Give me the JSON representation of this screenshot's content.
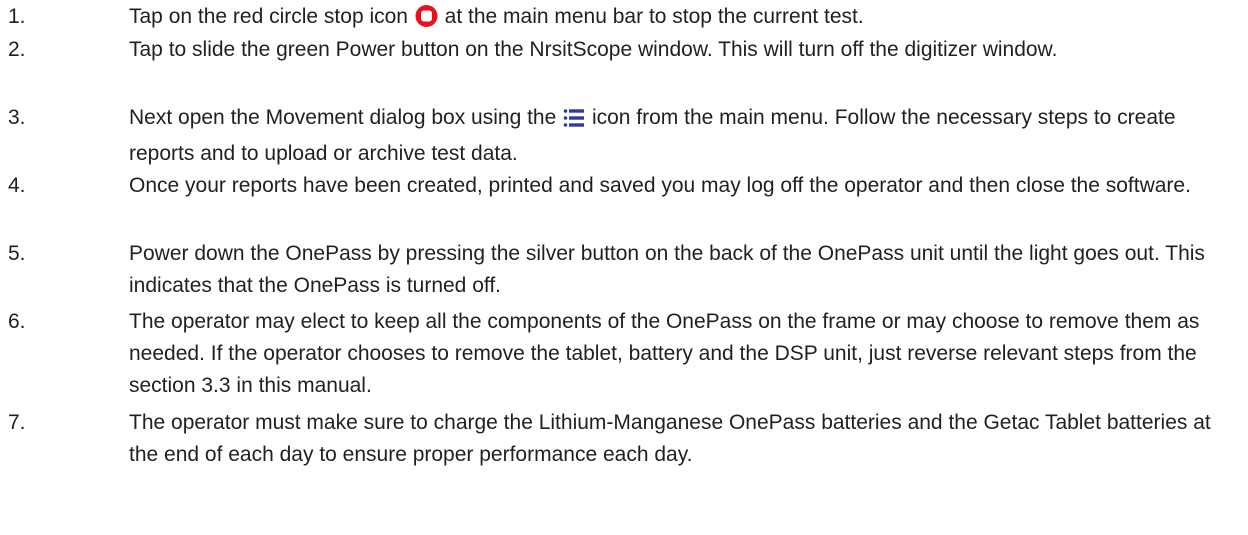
{
  "steps": [
    {
      "number": "1.",
      "before_icon": "Tap on the red circle stop icon ",
      "icon": "stop-icon",
      "after_icon": " at the main menu bar to stop the current test."
    },
    {
      "number": "2.",
      "text": "Tap to slide the green Power button on the NrsitScope window. This will turn off the digitizer window."
    },
    {
      "number": "3.",
      "before_icon": "Next open the Movement dialog box using the ",
      "icon": "list-menu-icon",
      "after_icon": " icon from the main menu. Follow the necessary steps to create reports and to upload or archive test data."
    },
    {
      "number": "4.",
      "text": "Once your reports have been created, printed and saved you may log off the operator and then close the software."
    },
    {
      "number": "5.",
      "text": "Power down the OnePass by pressing the silver button on the back of the OnePass unit until the light goes out. This indicates that the OnePass is turned off."
    },
    {
      "number": "6.",
      "text": "The operator may elect to keep all the components of the OnePass on the frame or may choose to remove them as needed. If the operator chooses to remove the tablet, battery and the DSP unit, just reverse relevant steps from the section 3.3 in this manual."
    },
    {
      "number": "7.",
      "text": "The operator must make sure to charge the Lithium-Manganese OnePass batteries and the Getac Tablet batteries at the end of each day to ensure proper performance each day."
    }
  ],
  "colors": {
    "stop_icon": "#e8101e",
    "menu_icon": "#2f3a9a",
    "text": "#231f20"
  }
}
